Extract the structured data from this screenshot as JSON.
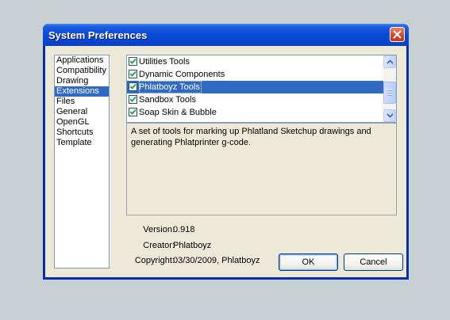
{
  "window": {
    "title": "System Preferences"
  },
  "categories": [
    {
      "label": "Applications",
      "selected": false
    },
    {
      "label": "Compatibility",
      "selected": false
    },
    {
      "label": "Drawing",
      "selected": false
    },
    {
      "label": "Extensions",
      "selected": true
    },
    {
      "label": "Files",
      "selected": false
    },
    {
      "label": "General",
      "selected": false
    },
    {
      "label": "OpenGL",
      "selected": false
    },
    {
      "label": "Shortcuts",
      "selected": false
    },
    {
      "label": "Template",
      "selected": false
    }
  ],
  "extensions": [
    {
      "label": "Utilities Tools",
      "checked": true,
      "selected": false
    },
    {
      "label": "Dynamic Components",
      "checked": true,
      "selected": false
    },
    {
      "label": "Phlatboyz Tools",
      "checked": true,
      "selected": true
    },
    {
      "label": "Sandbox Tools",
      "checked": true,
      "selected": false
    },
    {
      "label": "Soap Skin & Bubble",
      "checked": true,
      "selected": false
    }
  ],
  "details": {
    "description": "A set of tools for marking up Phlatland Sketchup drawings and generating Phlatprinter g-code.",
    "version_label": "Version:",
    "version": "0.918",
    "creator_label": "Creator:",
    "creator": "Phlatboyz",
    "copyright_label": "Copyright:",
    "copyright": "03/30/2009, Phlatboyz"
  },
  "buttons": {
    "ok": "OK",
    "cancel": "Cancel"
  },
  "colors": {
    "title_bar": "#0846d2",
    "selection": "#316ac5",
    "client_bg": "#ece9d8",
    "close_button": "#d2492a"
  }
}
